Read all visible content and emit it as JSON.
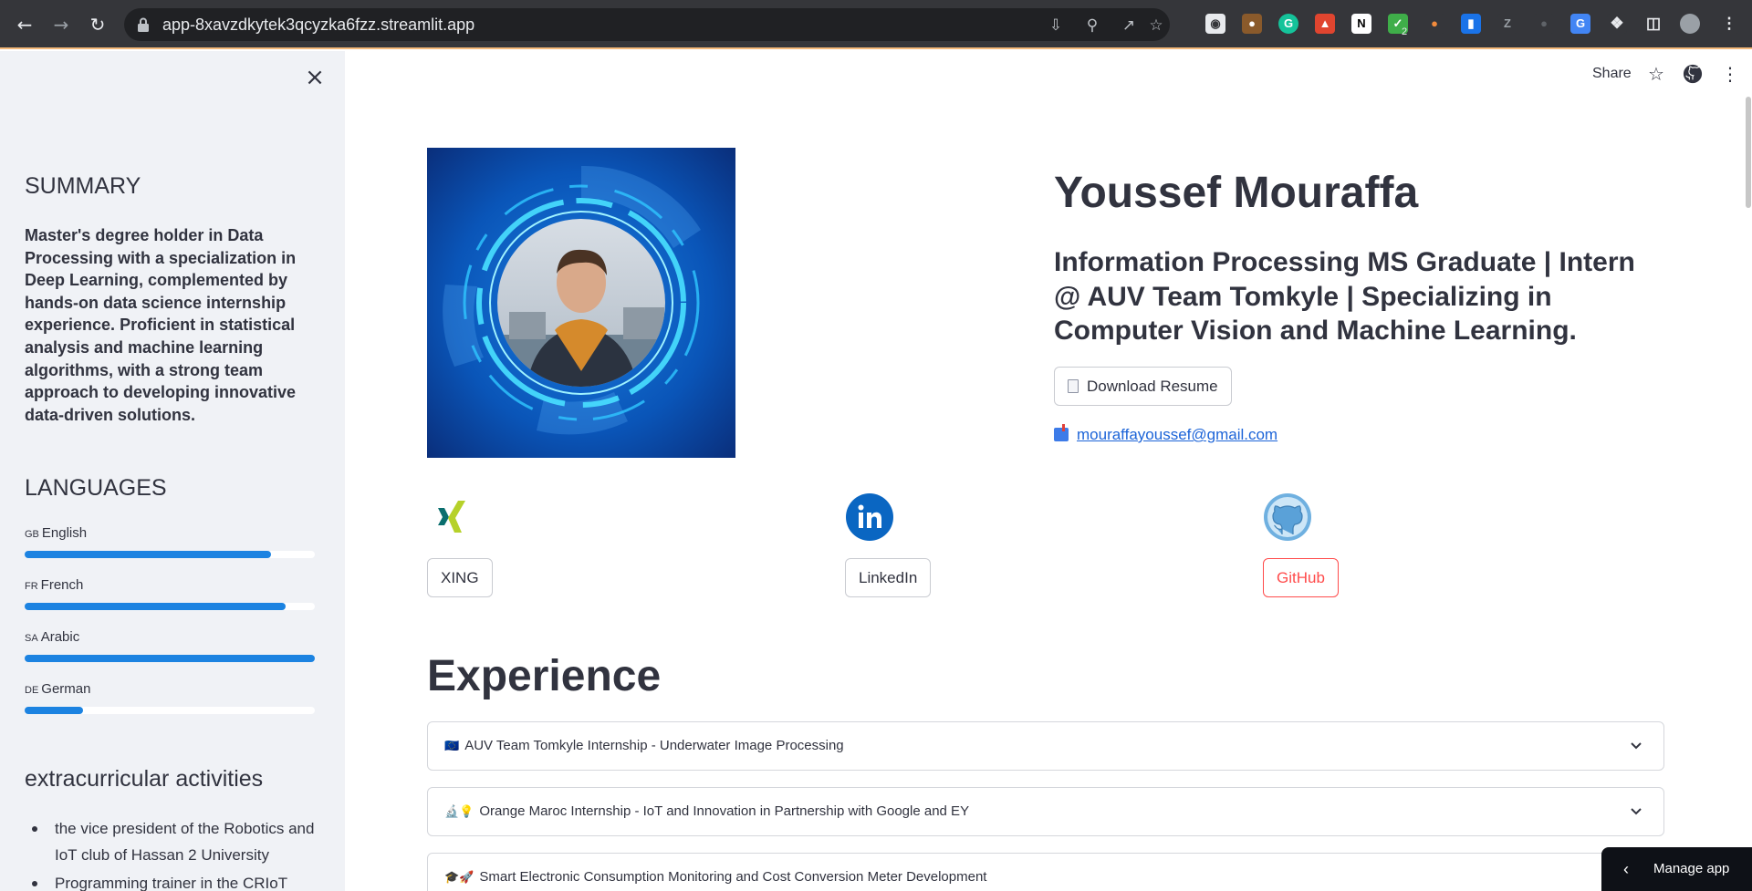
{
  "browser": {
    "url": "app-8xavzdkytek3qcyzka6fzz.streamlit.app",
    "extension_badge": "2"
  },
  "sidebar": {
    "summary_heading": "SUMMARY",
    "summary_text": "Master's degree holder in Data Processing with a specialization in Deep Learning, complemented by hands-on data science internship experience. Proficient in statistical analysis and machine learning algorithms, with a strong team approach to developing innovative data-driven solutions.",
    "languages_heading": "LANGUAGES",
    "languages": [
      {
        "code": "GB",
        "name": "English",
        "level": 0.85
      },
      {
        "code": "FR",
        "name": "French",
        "level": 0.9
      },
      {
        "code": "SA",
        "name": "Arabic",
        "level": 1.0
      },
      {
        "code": "DE",
        "name": "German",
        "level": 0.2
      }
    ],
    "extracurricular_heading": "extracurricular activities",
    "extracurricular": [
      "the vice president of the Robotics and IoT club of Hassan 2 University",
      "Programming trainer in the CRIoT"
    ]
  },
  "main": {
    "share_label": "Share",
    "name": "Youssef Mouraffa",
    "headline": "Information Processing MS Graduate | Intern @ AUV Team Tomkyle | Specializing in Computer Vision and Machine Learning.",
    "download_label": "Download Resume",
    "email": "mouraffayoussef@gmail.com",
    "socials": [
      {
        "label": "XING"
      },
      {
        "label": "LinkedIn"
      },
      {
        "label": "GitHub"
      }
    ],
    "experience_heading": "Experience",
    "experience": [
      {
        "emoji": "🇪🇺",
        "label": "AUV Team Tomkyle Internship - Underwater Image Processing"
      },
      {
        "emoji": "🔬💡",
        "label": "Orange Maroc Internship - IoT and Innovation in Partnership with Google and EY"
      },
      {
        "emoji": "🎓🚀",
        "label": "Smart Electronic Consumption Monitoring and Cost Conversion Meter Development"
      }
    ],
    "manage_app_label": "Manage app"
  }
}
